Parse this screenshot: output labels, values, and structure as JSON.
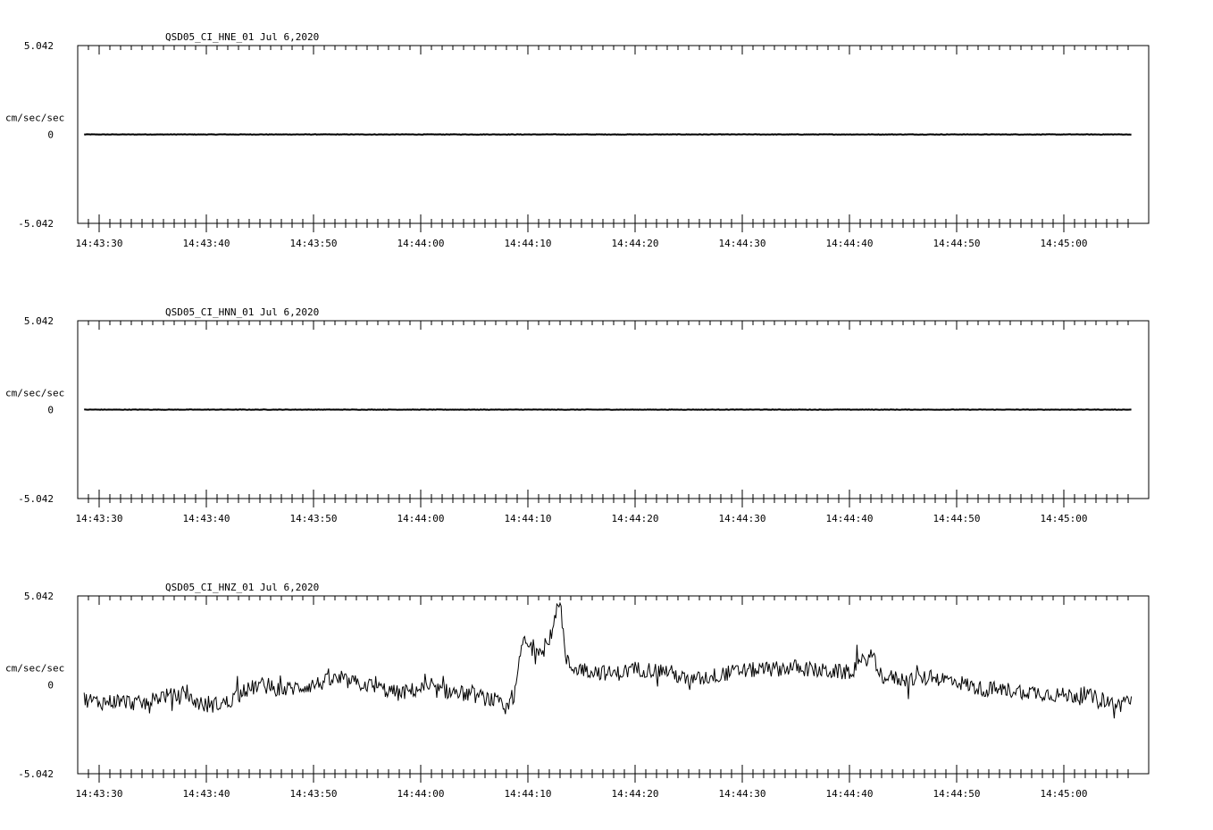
{
  "chart_data": [
    {
      "type": "line",
      "title": "QSD05_CI_HNE_01  Jul 6,2020",
      "ylabel": "cm/sec/sec",
      "ylim": [
        -5.042,
        5.042
      ],
      "y_tick_labels": [
        "5.042",
        "0",
        "-5.042"
      ],
      "x_tick_labels": [
        "14:43:30",
        "14:43:40",
        "14:43:50",
        "14:44:00",
        "14:44:10",
        "14:44:20",
        "14:44:30",
        "14:44:40",
        "14:44:50",
        "14:45:00"
      ],
      "xlim": [
        "14:43:28.6",
        "14:45:06.3"
      ],
      "series": [
        {
          "x": [
            "14:43:28.6",
            "14:43:40",
            "14:43:50",
            "14:44:00",
            "14:44:10",
            "14:44:20",
            "14:44:30",
            "14:44:40",
            "14:44:50",
            "14:45:00",
            "14:45:06.3"
          ],
          "values": [
            0,
            0,
            0,
            0,
            0,
            0,
            0,
            0,
            0,
            0,
            0
          ]
        }
      ]
    },
    {
      "type": "line",
      "title": "QSD05_CI_HNN_01  Jul 6,2020",
      "ylabel": "cm/sec/sec",
      "ylim": [
        -5.042,
        5.042
      ],
      "y_tick_labels": [
        "5.042",
        "0",
        "-5.042"
      ],
      "x_tick_labels": [
        "14:43:30",
        "14:43:40",
        "14:43:50",
        "14:44:00",
        "14:44:10",
        "14:44:20",
        "14:44:30",
        "14:44:40",
        "14:44:50",
        "14:45:00"
      ],
      "xlim": [
        "14:43:28.6",
        "14:45:06.3"
      ],
      "series": [
        {
          "x": [
            "14:43:28.6",
            "14:43:40",
            "14:43:50",
            "14:44:00",
            "14:44:10",
            "14:44:20",
            "14:44:30",
            "14:44:40",
            "14:44:50",
            "14:45:00",
            "14:45:06.3"
          ],
          "values": [
            0,
            0,
            0,
            0,
            0,
            0,
            0,
            0,
            0,
            0,
            0
          ]
        }
      ]
    },
    {
      "type": "line",
      "title": "QSD05_CI_HNZ_01  Jul 6,2020",
      "ylabel": "cm/sec/sec",
      "ylim": [
        -5.042,
        5.042
      ],
      "y_tick_labels": [
        "5.042",
        "0",
        "-5.042"
      ],
      "x_tick_labels": [
        "14:43:30",
        "14:43:40",
        "14:43:50",
        "14:44:00",
        "14:44:10",
        "14:44:20",
        "14:44:30",
        "14:44:40",
        "14:44:50",
        "14:45:00"
      ],
      "xlim": [
        "14:43:28.6",
        "14:45:06.3"
      ],
      "series": [
        {
          "x": [
            "14:43:28.6",
            "14:43:30",
            "14:43:32",
            "14:43:34",
            "14:43:36",
            "14:43:38",
            "14:43:40",
            "14:43:42",
            "14:43:43",
            "14:43:45",
            "14:43:47",
            "14:43:50",
            "14:43:52",
            "14:43:55",
            "14:43:58",
            "14:44:00",
            "14:44:03",
            "14:44:05",
            "14:44:07",
            "14:44:08",
            "14:44:08.8",
            "14:44:09.5",
            "14:44:10",
            "14:44:11",
            "14:44:12",
            "14:44:12.5",
            "14:44:13",
            "14:44:13.5",
            "14:44:14",
            "14:44:16",
            "14:44:18",
            "14:44:20",
            "14:44:23",
            "14:44:25",
            "14:44:28",
            "14:44:30",
            "14:44:33",
            "14:44:35",
            "14:44:37",
            "14:44:40",
            "14:44:42",
            "14:44:43",
            "14:44:45",
            "14:44:48",
            "14:44:50",
            "14:44:52",
            "14:44:55",
            "14:44:57",
            "14:45:00",
            "14:45:02",
            "14:45:04",
            "14:45:05",
            "14:45:06.3"
          ],
          "values": [
            -0.8,
            -1.0,
            -0.9,
            -1.1,
            -0.6,
            -0.7,
            -1.2,
            -1.0,
            -0.5,
            0.0,
            -0.3,
            0.0,
            0.3,
            0.0,
            -0.5,
            -0.2,
            -0.4,
            -0.6,
            -0.9,
            -1.5,
            -0.5,
            2.5,
            2.2,
            2.1,
            2.3,
            3.6,
            5.0,
            1.5,
            1.0,
            0.8,
            0.6,
            0.9,
            0.8,
            0.2,
            0.6,
            0.8,
            0.9,
            1.0,
            0.8,
            0.7,
            1.7,
            0.5,
            0.3,
            0.4,
            0.2,
            -0.2,
            -0.3,
            -0.4,
            -0.6,
            -0.6,
            -0.9,
            -1.2,
            -0.8
          ]
        }
      ]
    }
  ]
}
